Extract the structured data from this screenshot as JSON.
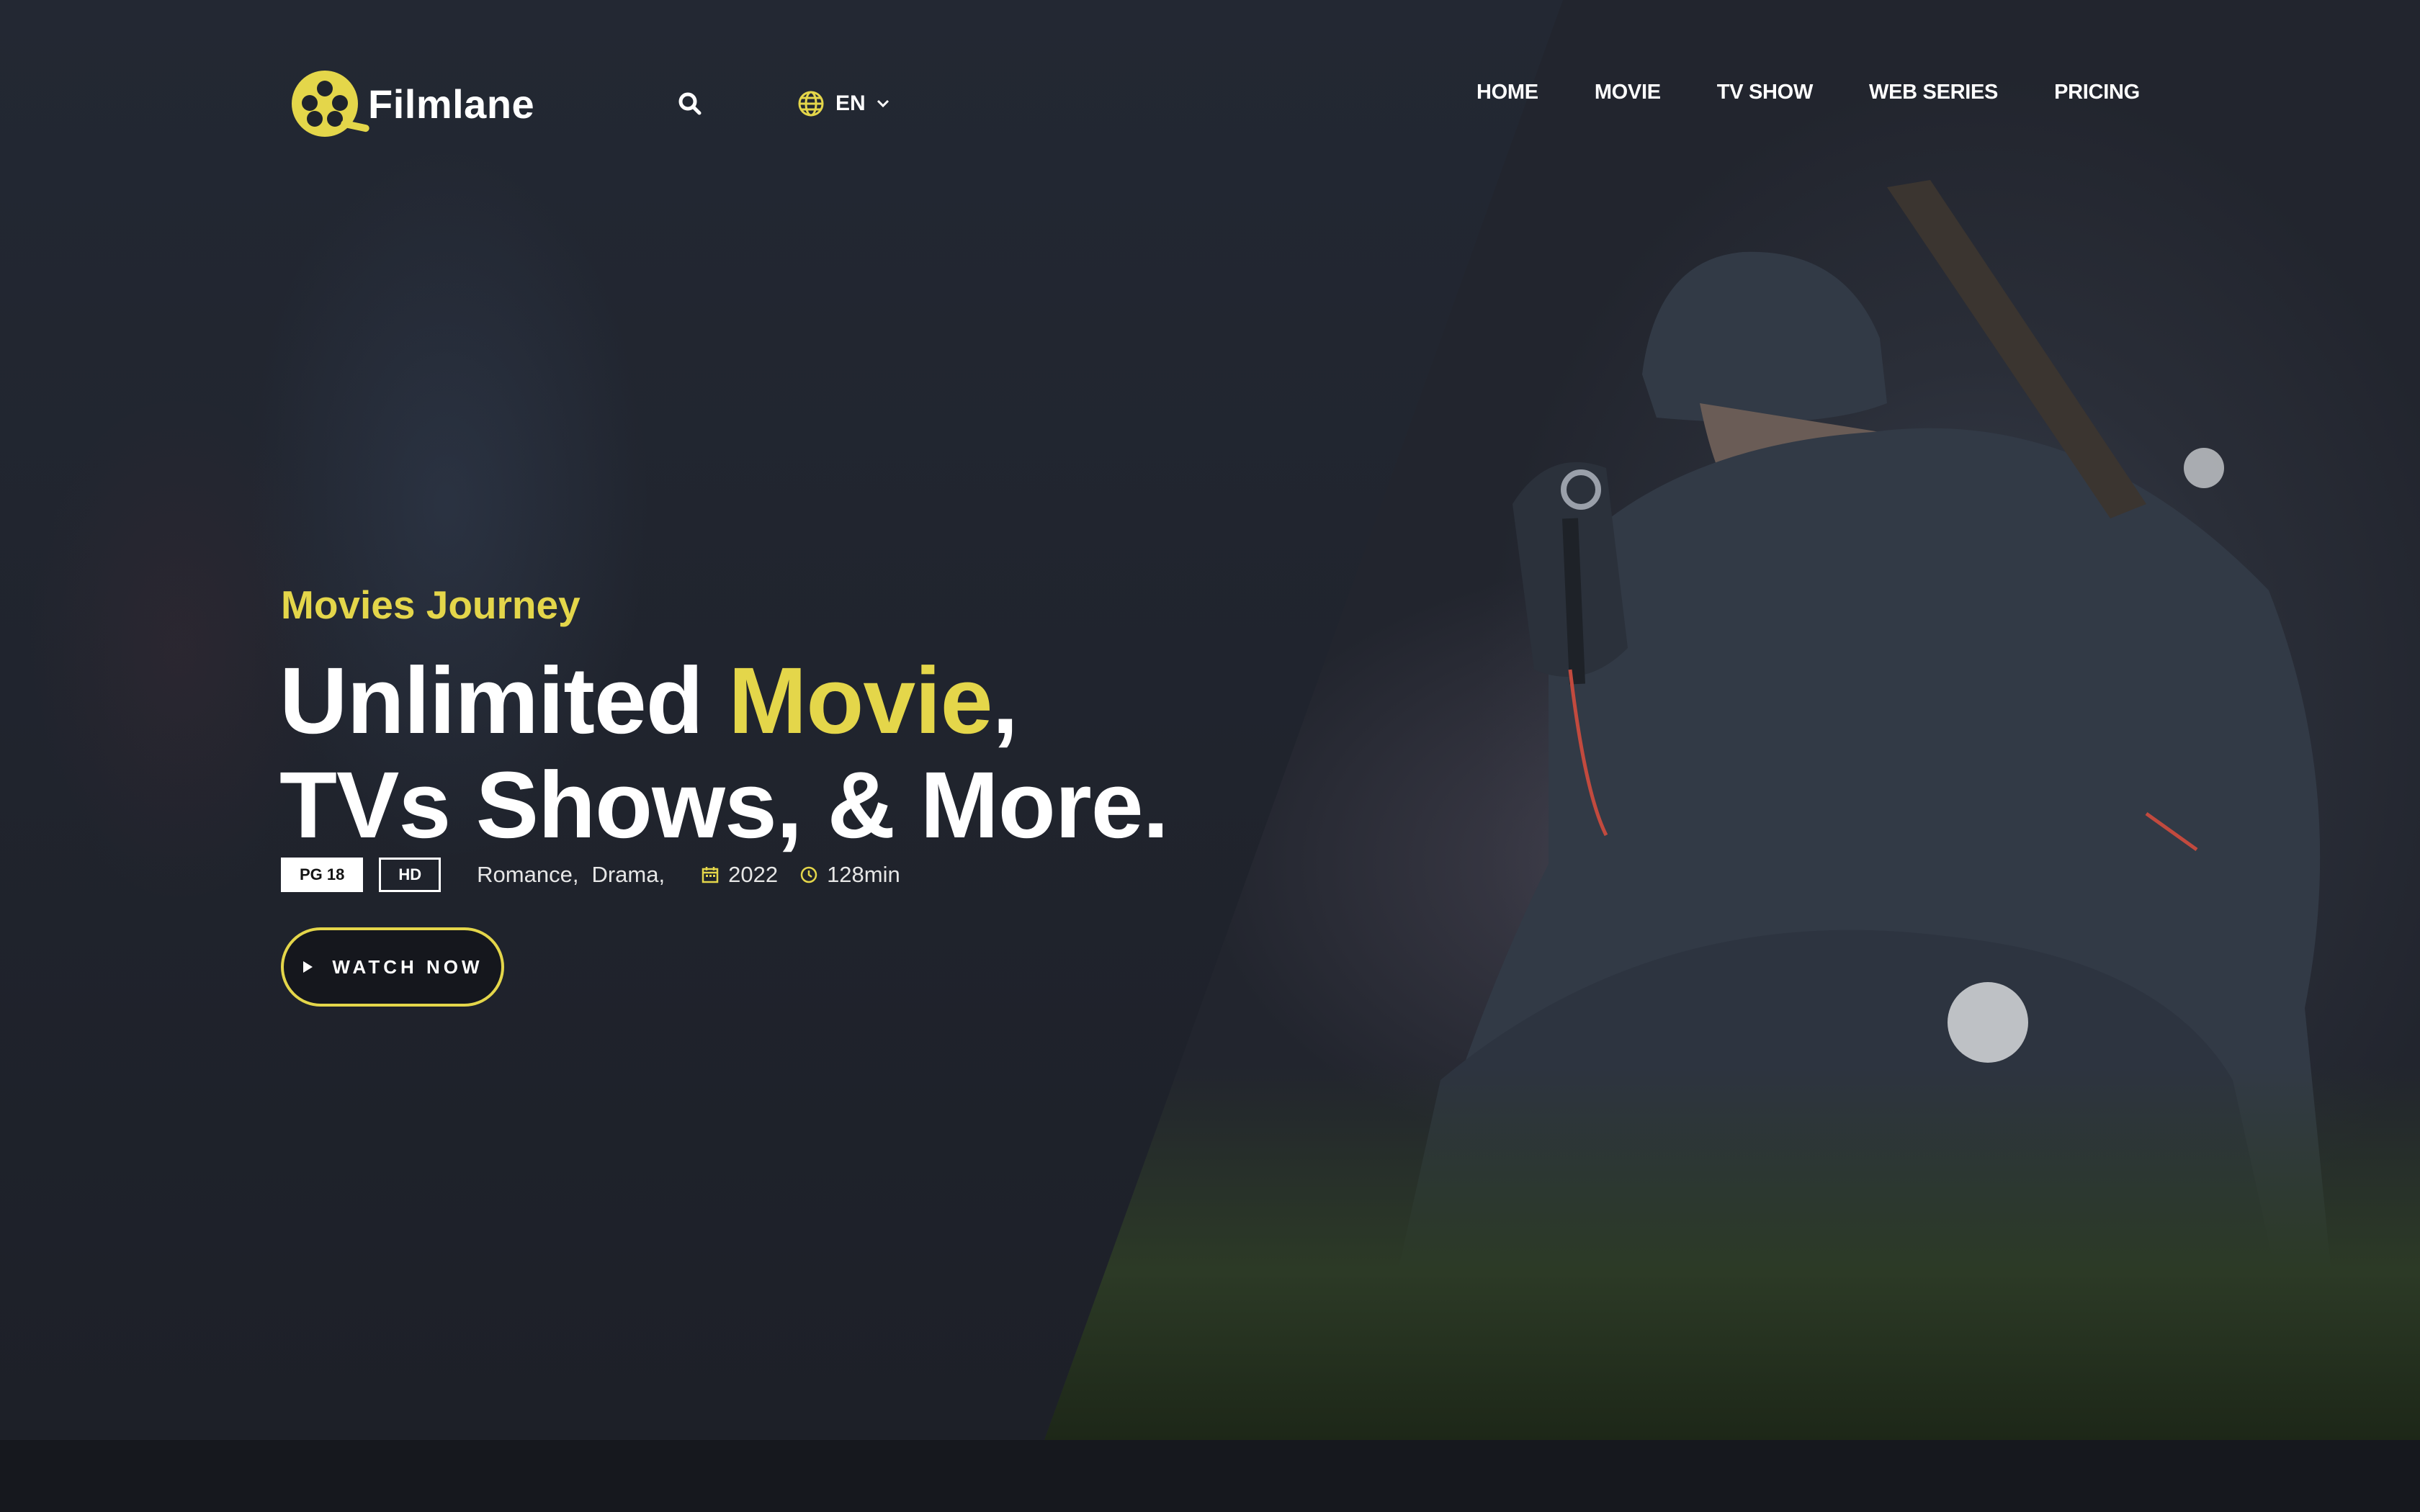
{
  "brand": {
    "name": "Filmlane",
    "accent_color": "#e4d64a"
  },
  "header": {
    "search_icon": "search-icon",
    "language": {
      "icon": "globe-icon",
      "label": "EN",
      "chevron": "chevron-down-icon"
    },
    "nav": [
      "HOME",
      "MOVIE",
      "TV SHOW",
      "WEB SERIES",
      "PRICING"
    ]
  },
  "hero": {
    "eyebrow": "Movies Journey",
    "title_part1": "Unlimited ",
    "title_accent": "Movie",
    "title_part2": ",",
    "title_line2": "TVs Shows, & More.",
    "badges": [
      "PG 18",
      "HD"
    ],
    "genres": [
      "Romance,",
      "Drama,"
    ],
    "year": "2022",
    "duration": "128min",
    "cta_label": "WATCH NOW"
  }
}
